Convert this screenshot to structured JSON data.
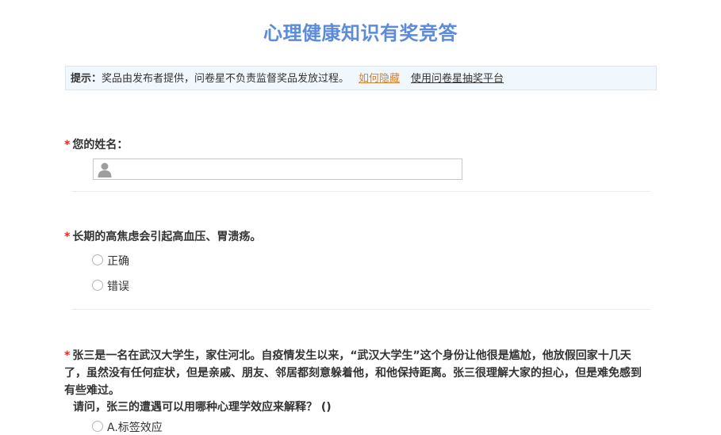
{
  "page": {
    "title": "心理健康知识有奖竞答"
  },
  "notice": {
    "label": "提示：",
    "text": "奖品由发布者提供，问卷星不负责监督奖品发放过程。",
    "link_hide": "如何隐藏",
    "link_platform": "使用问卷星抽奖平台"
  },
  "q1": {
    "required": "*",
    "label": "您的姓名：",
    "value": "",
    "placeholder": ""
  },
  "q2": {
    "required": "*",
    "label": "长期的高焦虑会引起高血压、胃溃疡。",
    "options": [
      "正确",
      "错误"
    ]
  },
  "q3": {
    "required": "*",
    "text": "张三是一名在武汉大学生，家住河北。自疫情发生以来，“武汉大学生”这个身份让他很是尴尬，他放假回家十几天了，虽然没有任何症状，但是亲戚、朋友、邻居都刻意躲着他，和他保持距离。张三很理解大家的担心，但是难免感到有些难过。",
    "question": "请问，张三的遭遇可以用哪种心理学效应来解释？  ()",
    "options": [
      "A.标签效应"
    ]
  },
  "colors": {
    "title": "#5b8be1",
    "required": "#e32b2b",
    "link": "#d8822a",
    "notice_bg": "#f0f8fd"
  },
  "icons": {
    "name_field": "person-icon",
    "radio": "radio-circle"
  }
}
